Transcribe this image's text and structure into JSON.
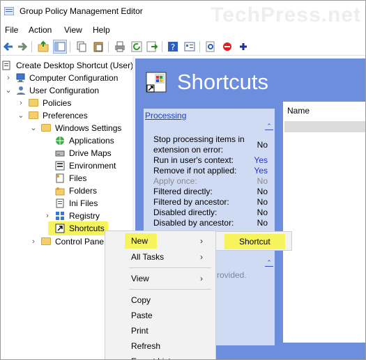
{
  "window": {
    "title": "Group Policy Management Editor",
    "watermark": "TechPress.net"
  },
  "menubar": {
    "items": [
      "File",
      "Action",
      "View",
      "Help"
    ]
  },
  "toolbar": {
    "icons": [
      "back-icon",
      "forward-icon",
      "up-folder-icon",
      "show-hide-tree-icon",
      "copy-icon",
      "paste-icon",
      "print-icon",
      "refresh-icon",
      "export-icon",
      "help-icon",
      "properties-icon",
      "filter-icon",
      "delete-icon",
      "add-icon"
    ]
  },
  "tree": {
    "items": [
      {
        "label": "Create Desktop Shortcut (User)",
        "icon": "policy-icon"
      },
      {
        "label": "Computer Configuration",
        "icon": "computer-icon"
      },
      {
        "label": "User Configuration",
        "icon": "user-icon"
      },
      {
        "label": "Policies",
        "icon": "folder-icon"
      },
      {
        "label": "Preferences",
        "icon": "folder-icon"
      },
      {
        "label": "Windows Settings",
        "icon": "folder-icon"
      },
      {
        "label": "Applications",
        "icon": "globe-icon"
      },
      {
        "label": "Drive Maps",
        "icon": "drive-icon"
      },
      {
        "label": "Environment",
        "icon": "environment-icon"
      },
      {
        "label": "Files",
        "icon": "file-icon"
      },
      {
        "label": "Folders",
        "icon": "folders-icon"
      },
      {
        "label": "Ini Files",
        "icon": "ini-file-icon"
      },
      {
        "label": "Registry",
        "icon": "registry-icon"
      },
      {
        "label": "Shortcuts",
        "icon": "shortcut-icon"
      },
      {
        "label": "Control Pane",
        "icon": "control-panel-icon"
      }
    ]
  },
  "content": {
    "title": "Shortcuts",
    "panel": {
      "header": "Processing",
      "properties": [
        {
          "key": "Stop processing items in extension on error:",
          "value": "No"
        },
        {
          "key": "Run in user's context:",
          "value": "Yes"
        },
        {
          "key": "Remove if not applied:",
          "value": "Yes"
        },
        {
          "key": "Apply once:",
          "value": "No"
        },
        {
          "key": "Filtered directly:",
          "value": "No"
        },
        {
          "key": "Filtered by ancestor:",
          "value": "No"
        },
        {
          "key": "Disabled directly:",
          "value": "No"
        },
        {
          "key": "Disabled by ancestor:",
          "value": "No"
        }
      ],
      "bottom_text": "rovided."
    },
    "list": {
      "column_name": "Name"
    }
  },
  "context_menu": {
    "items": [
      {
        "label": "New",
        "submenu": true
      },
      {
        "label": "All Tasks",
        "submenu": true
      },
      {
        "label": "View",
        "submenu": true
      },
      {
        "label": "Copy",
        "submenu": false
      },
      {
        "label": "Paste",
        "submenu": false
      },
      {
        "label": "Print",
        "submenu": false
      },
      {
        "label": "Refresh",
        "submenu": false
      },
      {
        "label": "Export List...",
        "submenu": false
      }
    ],
    "submenu_arrow": "›"
  },
  "submenu": {
    "items": [
      "Shortcut"
    ]
  },
  "colors": {
    "highlight": "#f7f35c",
    "content_bg": "#6c8edd",
    "panel_bg": "#cfdaf3",
    "link": "#1a3fbf"
  }
}
